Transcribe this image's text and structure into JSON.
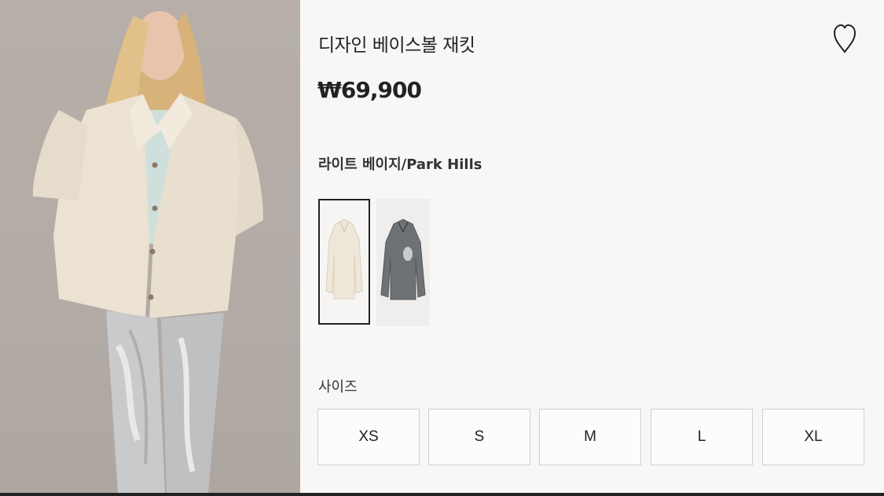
{
  "product": {
    "title": "디자인 베이스볼 재킷",
    "price": "₩69,900",
    "color_label": "라이트 베이지/Park Hills",
    "size_label": "사이즈"
  },
  "swatches": [
    {
      "color": "light-beige",
      "selected": true
    },
    {
      "color": "dark-gray",
      "selected": false
    }
  ],
  "sizes": [
    "XS",
    "S",
    "M",
    "L",
    "XL"
  ],
  "icons": {
    "wishlist": "heart-outline-icon"
  },
  "colors": {
    "background": "#f8f7f5",
    "text": "#222222",
    "border": "#cfcfcf",
    "selected_border": "#222222"
  }
}
